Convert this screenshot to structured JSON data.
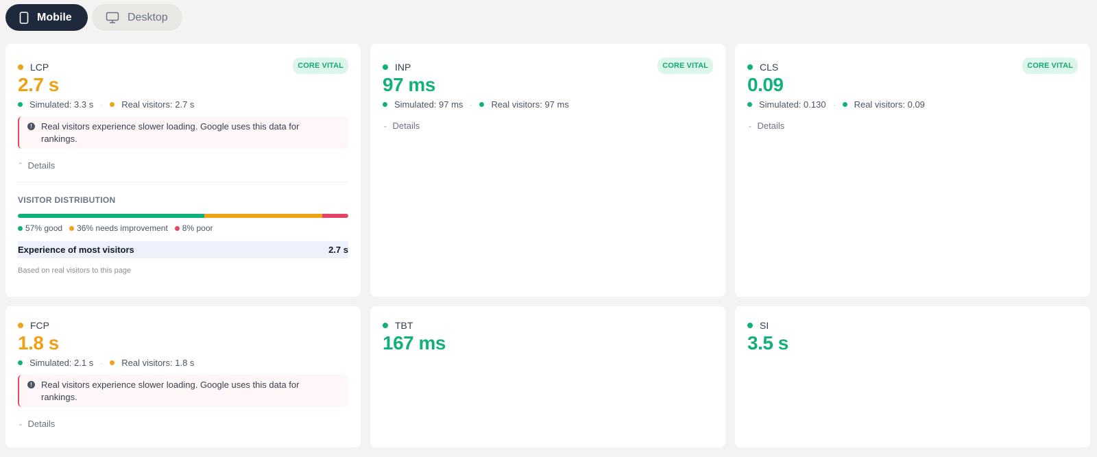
{
  "tabs": [
    {
      "label": "Mobile",
      "icon": "phone-icon",
      "active": true
    },
    {
      "label": "Desktop",
      "icon": "monitor-icon",
      "active": false
    }
  ],
  "colors": {
    "good": "#10b07d",
    "needs_improvement": "#efa317",
    "poor": "#e24567",
    "accent_dark": "#1e2a3c"
  },
  "cards": [
    {
      "name": "LCP",
      "status": "needs-improvement",
      "core_vital": "CORE VITAL",
      "value": "2.7 s",
      "simulated": "Simulated: 3.3 s",
      "real": "Real visitors: 2.7 s",
      "alert": "Real visitors experience slower loading. Google uses this data for rankings.",
      "details": "Details",
      "expanded": true,
      "distribution": {
        "title": "VISITOR DISTRIBUTION",
        "good_pct": 57,
        "ni_pct": 36,
        "poor_pct": 8,
        "good_label": "57% good",
        "ni_label": "36% needs improvement",
        "poor_label": "8% poor",
        "experience_label": "Experience of most visitors",
        "experience_value": "2.7 s",
        "note": "Based on real visitors to this page"
      }
    },
    {
      "name": "INP",
      "status": "good",
      "core_vital": "CORE VITAL",
      "value": "97 ms",
      "simulated": "Simulated: 97 ms",
      "real": "Real visitors: 97 ms",
      "details": "Details"
    },
    {
      "name": "CLS",
      "status": "good",
      "core_vital": "CORE VITAL",
      "value": "0.09",
      "simulated": "Simulated: 0.130",
      "real": "Real visitors: 0.09",
      "details": "Details"
    },
    {
      "name": "FCP",
      "status": "needs-improvement",
      "value": "1.8 s",
      "simulated": "Simulated: 2.1 s",
      "real": "Real visitors: 1.8 s",
      "alert": "Real visitors experience slower loading. Google uses this data for rankings.",
      "details": "Details"
    },
    {
      "name": "TBT",
      "status": "good",
      "value": "167 ms"
    },
    {
      "name": "SI",
      "status": "good",
      "value": "3.5 s"
    }
  ]
}
